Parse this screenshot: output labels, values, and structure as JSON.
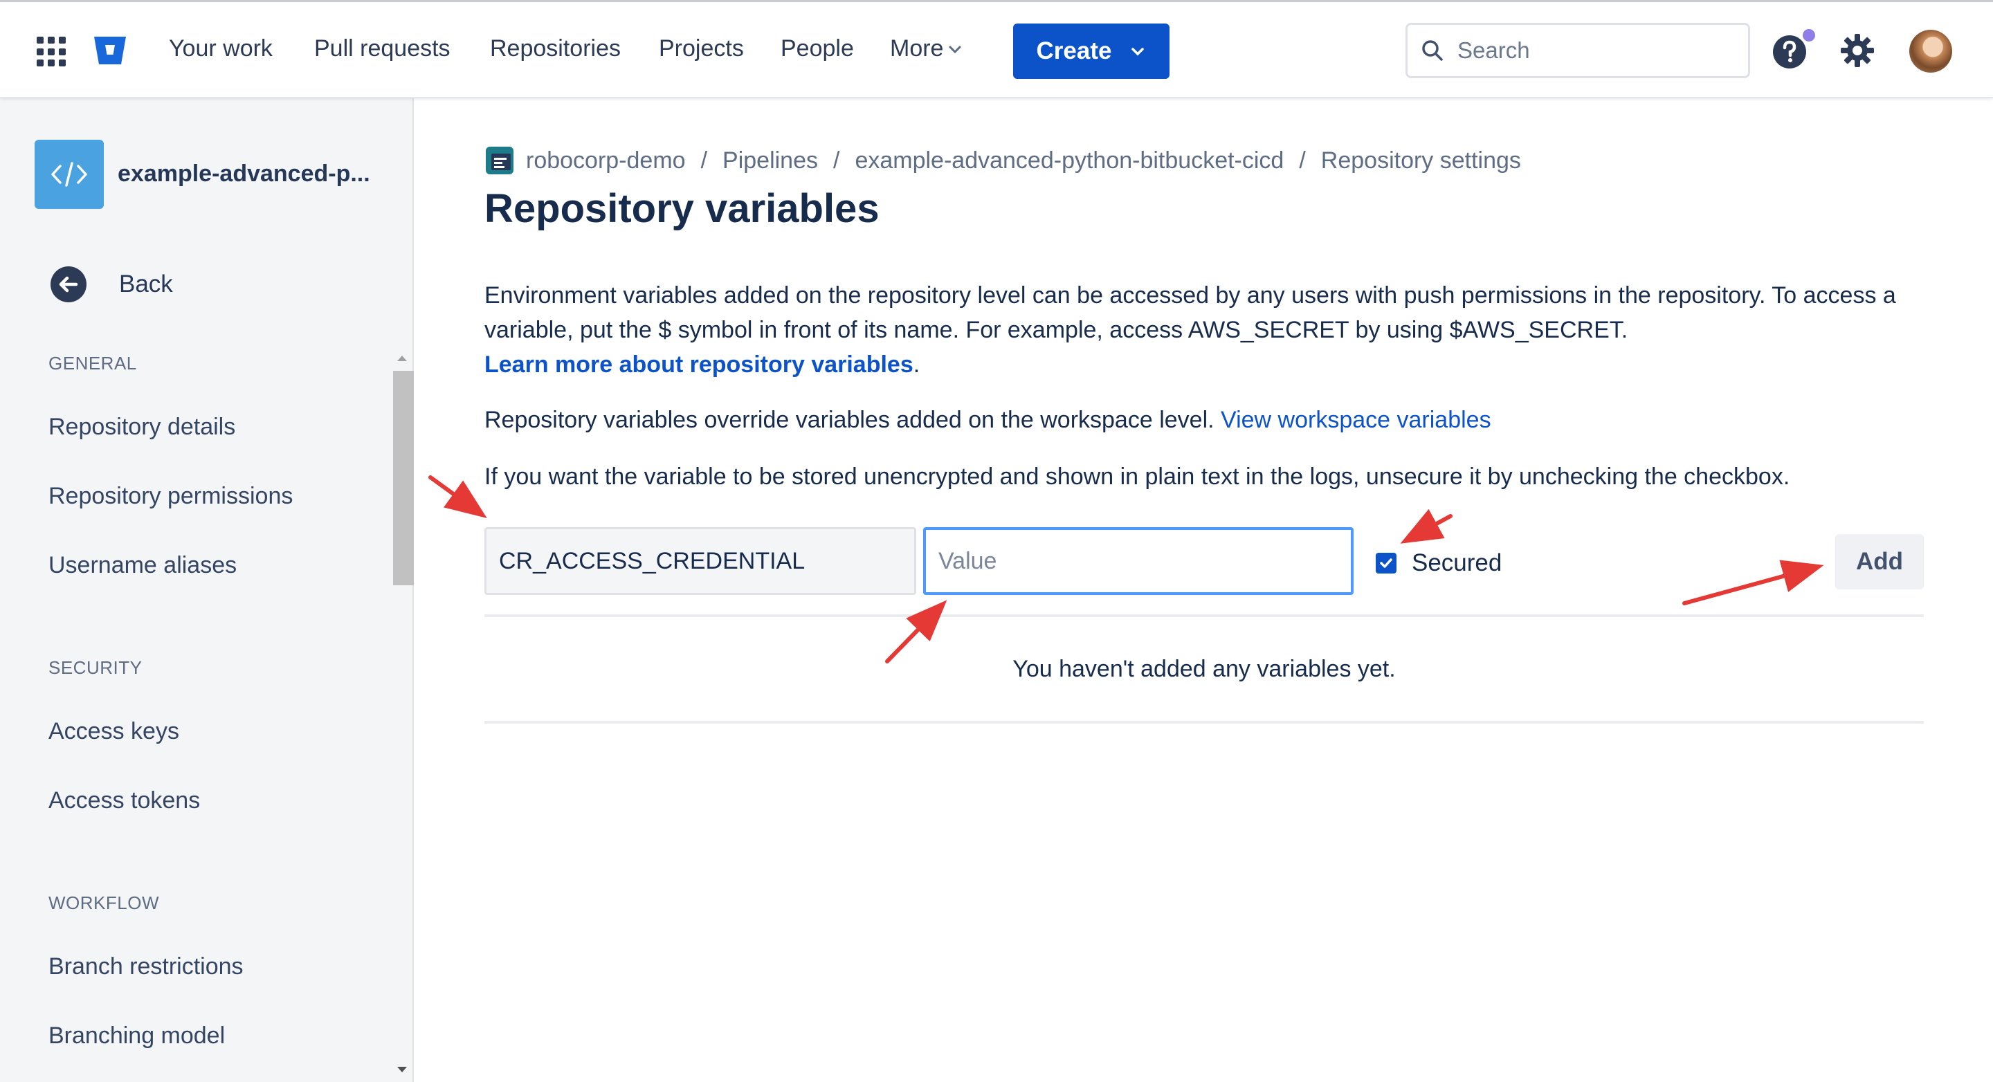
{
  "nav": {
    "items": [
      "Your work",
      "Pull requests",
      "Repositories",
      "Projects",
      "People"
    ],
    "more_label": "More",
    "create_label": "Create",
    "search_placeholder": "Search"
  },
  "sidebar": {
    "repo_name": "example-advanced-p...",
    "back_label": "Back",
    "sections": [
      {
        "title": "GENERAL",
        "items": [
          "Repository details",
          "Repository permissions",
          "Username aliases"
        ]
      },
      {
        "title": "SECURITY",
        "items": [
          "Access keys",
          "Access tokens"
        ]
      },
      {
        "title": "WORKFLOW",
        "items": [
          "Branch restrictions",
          "Branching model"
        ]
      }
    ]
  },
  "breadcrumb": [
    "robocorp-demo",
    "Pipelines",
    "example-advanced-python-bitbucket-cicd",
    "Repository settings"
  ],
  "page": {
    "title": "Repository variables",
    "description": "Environment variables added on the repository level can be accessed by any users with push permissions in the repository. To access a variable, put the $ symbol in front of its name. For example, access AWS_SECRET by using $AWS_SECRET.",
    "learn_more_link": "Learn more about repository variables",
    "learn_more_suffix": ".",
    "override_text": "Repository variables override variables added on the workspace level.",
    "workspace_link": "View workspace variables",
    "unsecure_text": "If you want the variable to be stored unencrypted and shown in plain text in the logs, unsecure it by unchecking the checkbox.",
    "form": {
      "name_value": "CR_ACCESS_CREDENTIAL",
      "value_placeholder": "Value",
      "secured_label": "Secured",
      "secured_checked": true,
      "add_label": "Add"
    },
    "empty_message": "You haven't added any variables yet."
  },
  "colors": {
    "brand_blue": "#0c52c8",
    "focus_blue": "#4c9aff",
    "annotation_red": "#e53935",
    "sidebar_bg": "#f4f5f7"
  },
  "icons": [
    "app-switcher-icon",
    "bitbucket-logo-icon",
    "chevron-down-icon",
    "search-icon",
    "help-icon",
    "gear-icon",
    "code-icon",
    "arrow-left-icon",
    "workspace-icon",
    "check-icon"
  ]
}
